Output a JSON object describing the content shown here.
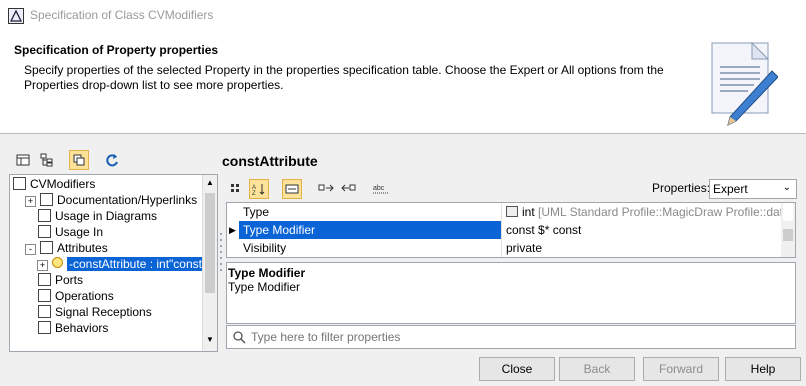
{
  "window": {
    "title": "Specification of Class CVModifiers"
  },
  "header": {
    "heading": "Specification of Property properties",
    "description": "Specify properties of the selected Property in the properties specification table. Choose the Expert or All options from the Properties drop-down list to see more properties."
  },
  "object_title": "constAttribute",
  "tree": {
    "items": [
      {
        "label": "CVModifiers",
        "indent": 0
      },
      {
        "label": "Documentation/Hyperlinks",
        "indent": 1,
        "expander": "+"
      },
      {
        "label": "Usage in Diagrams",
        "indent": 1
      },
      {
        "label": "Usage In",
        "indent": 1
      },
      {
        "label": "Attributes",
        "indent": 1,
        "expander": "-"
      },
      {
        "label": "-constAttribute : int\"const",
        "indent": 2,
        "expander": "+",
        "selected": true
      },
      {
        "label": "Ports",
        "indent": 1
      },
      {
        "label": "Operations",
        "indent": 1
      },
      {
        "label": "Signal Receptions",
        "indent": 1
      },
      {
        "label": "Behaviors",
        "indent": 1
      }
    ]
  },
  "properties_label": "Properties:",
  "properties_value": "Expert",
  "table": {
    "rows": [
      {
        "name": "Type",
        "value_main": "int",
        "value_extra": " [UML Standard Profile::MagicDraw Profile::dat..."
      },
      {
        "name": "Type Modifier",
        "value_main": "const $* const",
        "value_extra": "",
        "selected": true
      },
      {
        "name": "Visibility",
        "value_main": "private",
        "value_extra": ""
      }
    ]
  },
  "description_panel": {
    "title": "Type Modifier",
    "text": "Type Modifier"
  },
  "filter": {
    "placeholder": "Type here to filter properties"
  },
  "buttons": {
    "close": "Close",
    "back": "Back",
    "forward": "Forward",
    "help": "Help"
  },
  "colors": {
    "selection": "#0a64d6",
    "toggle_on": "#fde39a"
  },
  "icons": [
    "app-icon",
    "table-icon",
    "tree-icon",
    "compact-icon",
    "refresh-icon",
    "sort-alpha-icon",
    "collapse-icon",
    "expand-icon",
    "abc-icon",
    "search-icon"
  ]
}
